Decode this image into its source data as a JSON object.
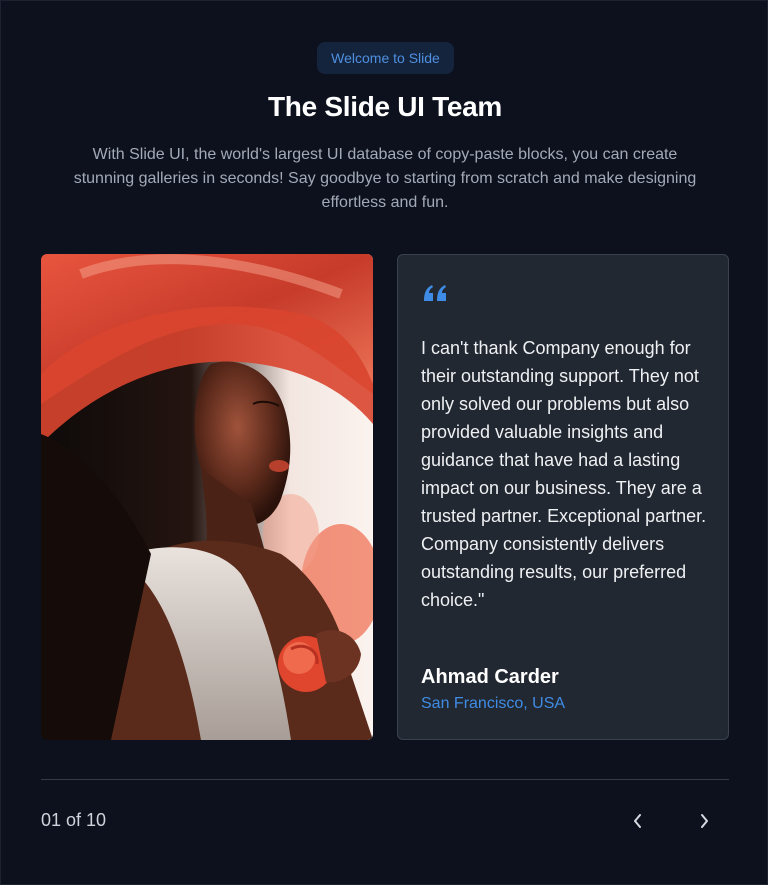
{
  "header": {
    "badge": "Welcome to Slide",
    "title": "The Slide UI Team",
    "subtitle": "With Slide UI, the world's largest UI database of copy-paste blocks, you can create stunning galleries in seconds! Say goodbye to starting from scratch and make designing effortless and fun."
  },
  "testimonial": {
    "quote_icon": "quote-icon",
    "quote": "I can't thank Company enough for their outstanding support. They not only solved our problems but also provided valuable insights and guidance that have had a lasting impact on our business. They are a trusted partner. Exceptional partner. Company consistently delivers outstanding results, our preferred choice.\"",
    "author": "Ahmad Carder",
    "location": "San Francisco, USA"
  },
  "pagination": {
    "counter": "01 of 10",
    "prev_icon": "chevron-left-icon",
    "next_icon": "chevron-right-icon"
  },
  "colors": {
    "background": "#0c111d",
    "accent": "#3f8ce6",
    "card": "#222831"
  }
}
